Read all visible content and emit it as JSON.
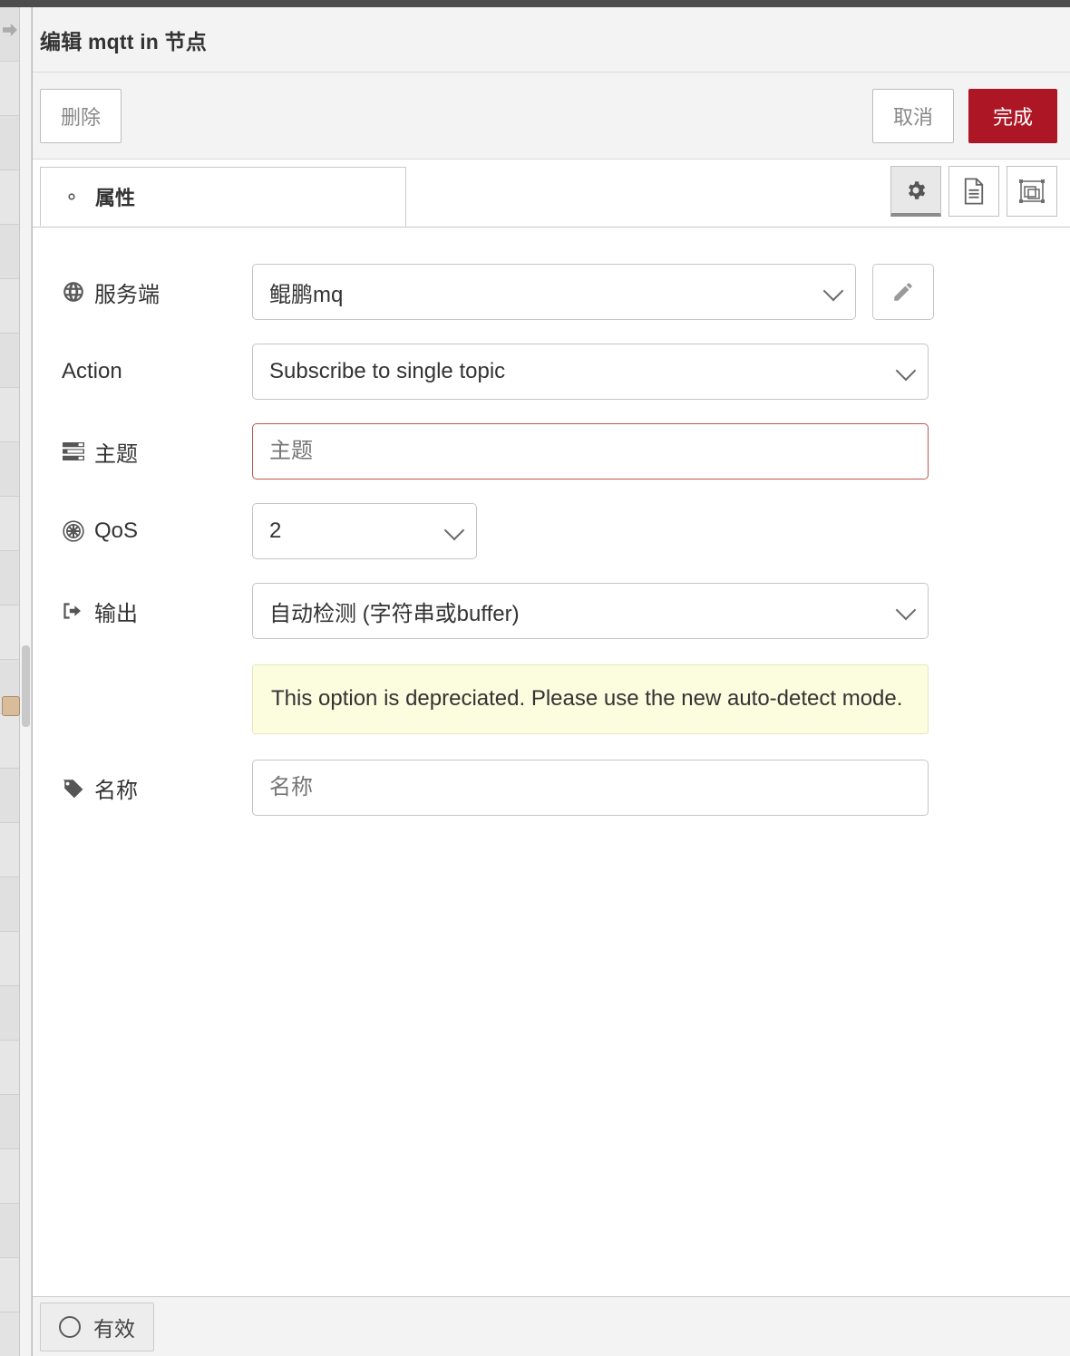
{
  "window": {
    "title": "编辑 mqtt in 节点"
  },
  "toolbar": {
    "delete_label": "删除",
    "cancel_label": "取消",
    "done_label": "完成",
    "done_color": "#ad1625",
    "icons": {
      "properties": "gear-icon",
      "description": "document-icon",
      "appearance": "appearance-icon"
    }
  },
  "tabs": [
    {
      "label": "属性",
      "icon": "gear-icon",
      "active": true
    }
  ],
  "form": {
    "server": {
      "label": "服务端",
      "icon": "globe-icon",
      "value": "鲲鹏mq",
      "edit_icon": "pencil-icon"
    },
    "action": {
      "label": "Action",
      "value": "Subscribe to single topic"
    },
    "topic": {
      "label": "主题",
      "icon": "tasks-icon",
      "value": "",
      "placeholder": "主题",
      "error": true,
      "error_color": "#c0564f"
    },
    "qos": {
      "label": "QoS",
      "icon": "empire-icon",
      "value": "2"
    },
    "output": {
      "label": "输出",
      "icon": "sign-out-icon",
      "value": "自动检测 (字符串或buffer)",
      "warning": "This option is depreciated. Please use the new auto-detect mode.",
      "warning_bg": "#fcfcdf"
    },
    "name": {
      "label": "名称",
      "icon": "tag-icon",
      "value": "",
      "placeholder": "名称"
    }
  },
  "footer": {
    "enable_label": "有效",
    "enable_icon": "circle-icon"
  }
}
